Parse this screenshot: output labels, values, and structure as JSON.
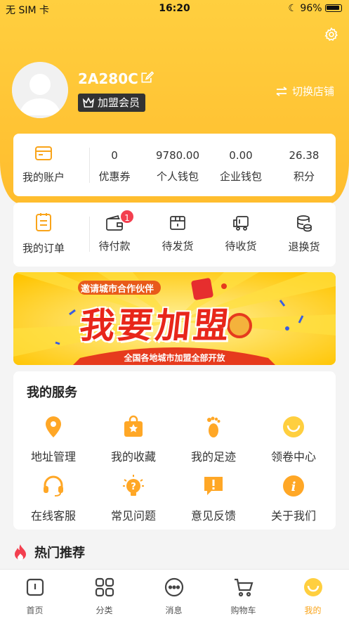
{
  "status_bar": {
    "carrier": "无 SIM 卡",
    "time": "16:20",
    "battery": "96%"
  },
  "profile": {
    "username": "2A280C",
    "member_badge": "加盟会员",
    "switch_store": "切换店铺"
  },
  "account": {
    "label": "我的账户",
    "stats": [
      {
        "value": "0",
        "label": "优惠券"
      },
      {
        "value": "9780.00",
        "label": "个人钱包"
      },
      {
        "value": "0.00",
        "label": "企业钱包"
      },
      {
        "value": "26.38",
        "label": "积分"
      }
    ]
  },
  "orders": {
    "label": "我的订单",
    "items": [
      {
        "label": "待付款",
        "icon": "wallet-icon",
        "badge": "1"
      },
      {
        "label": "待发货",
        "icon": "box-icon"
      },
      {
        "label": "待收货",
        "icon": "truck-icon"
      },
      {
        "label": "退换货",
        "icon": "coins-icon"
      }
    ]
  },
  "banner": {
    "top_text": "邀请城市合作伙伴",
    "main_text": "我要加盟",
    "bottom_text": "全国各地城市加盟全部开放"
  },
  "services": {
    "title": "我的服务",
    "items": [
      {
        "label": "地址管理",
        "icon": "location-icon"
      },
      {
        "label": "我的收藏",
        "icon": "favorite-bag-icon"
      },
      {
        "label": "我的足迹",
        "icon": "footprint-icon"
      },
      {
        "label": "领卷中心",
        "icon": "coupon-smile-icon"
      },
      {
        "label": "在线客服",
        "icon": "headset-icon"
      },
      {
        "label": "常见问题",
        "icon": "question-bulb-icon"
      },
      {
        "label": "意见反馈",
        "icon": "feedback-icon"
      },
      {
        "label": "关于我们",
        "icon": "info-icon"
      }
    ]
  },
  "hot": {
    "title": "热门推荐"
  },
  "tabbar": {
    "items": [
      {
        "label": "首页",
        "icon": "home-icon"
      },
      {
        "label": "分类",
        "icon": "category-icon"
      },
      {
        "label": "消息",
        "icon": "message-icon"
      },
      {
        "label": "购物车",
        "icon": "cart-icon"
      },
      {
        "label": "我的",
        "icon": "profile-smile-icon",
        "active": true
      }
    ]
  },
  "colors": {
    "brand": "#ffc233",
    "accent": "#f9a41a",
    "badge": "#f33f4f"
  }
}
